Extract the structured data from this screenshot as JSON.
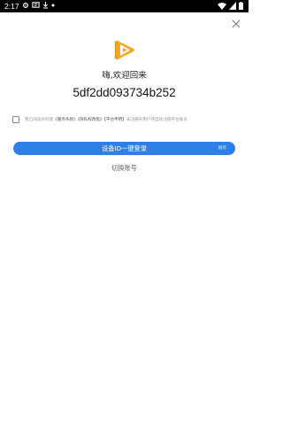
{
  "status_bar": {
    "time": "2:17",
    "icons_left": [
      "settings-icon",
      "notification-icon",
      "download-icon",
      "dot-icon"
    ],
    "icons_right": [
      "wifi-icon",
      "signal-icon",
      "battery-icon"
    ]
  },
  "login": {
    "welcome": "嗨,欢迎回来",
    "device_id": "5df2dd093734b252",
    "agreement": {
      "prefix": "我已阅读并同意",
      "terms": "《服务条款》",
      "privacy": "《隐私权政策》",
      "platform": "【平台申明】",
      "suffix": "未注册的用户将自动注册平台账号"
    },
    "login_button": "设备ID一键登录",
    "login_hint": "推荐",
    "switch_account": "切换账号"
  },
  "colors": {
    "primary": "#2f7fe8",
    "logo_orange": "#f6a623"
  }
}
